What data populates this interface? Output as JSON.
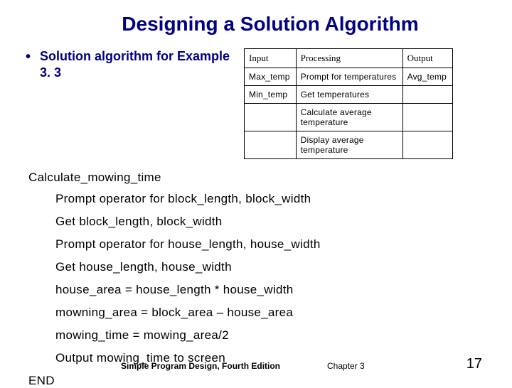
{
  "title": "Designing a Solution Algorithm",
  "bullet": "Solution algorithm for Example 3. 3",
  "ipo": {
    "headers": {
      "input": "Input",
      "processing": "Processing",
      "output": "Output"
    },
    "rows": [
      {
        "input": "Max_temp",
        "processing": "Prompt for temperatures",
        "output": "Avg_temp"
      },
      {
        "input": "Min_temp",
        "processing": "Get temperatures",
        "output": ""
      },
      {
        "input": "",
        "processing": "Calculate average temperature",
        "output": ""
      },
      {
        "input": "",
        "processing": "Display average temperature",
        "output": ""
      }
    ]
  },
  "algo": {
    "name": "Calculate_mowing_time",
    "steps": [
      "Prompt operator for block_length, block_width",
      "Get block_length, block_width",
      "Prompt operator for house_length, house_width",
      "Get house_length, house_width",
      "house_area = house_length * house_width",
      "mowning_area = block_area – house_area",
      "mowing_time = mowing_area/2",
      "Output mowing_time to screen"
    ],
    "end": "END"
  },
  "footer": {
    "book": "Simple Program Design, Fourth Edition",
    "chapter": "Chapter 3",
    "page": "17"
  }
}
